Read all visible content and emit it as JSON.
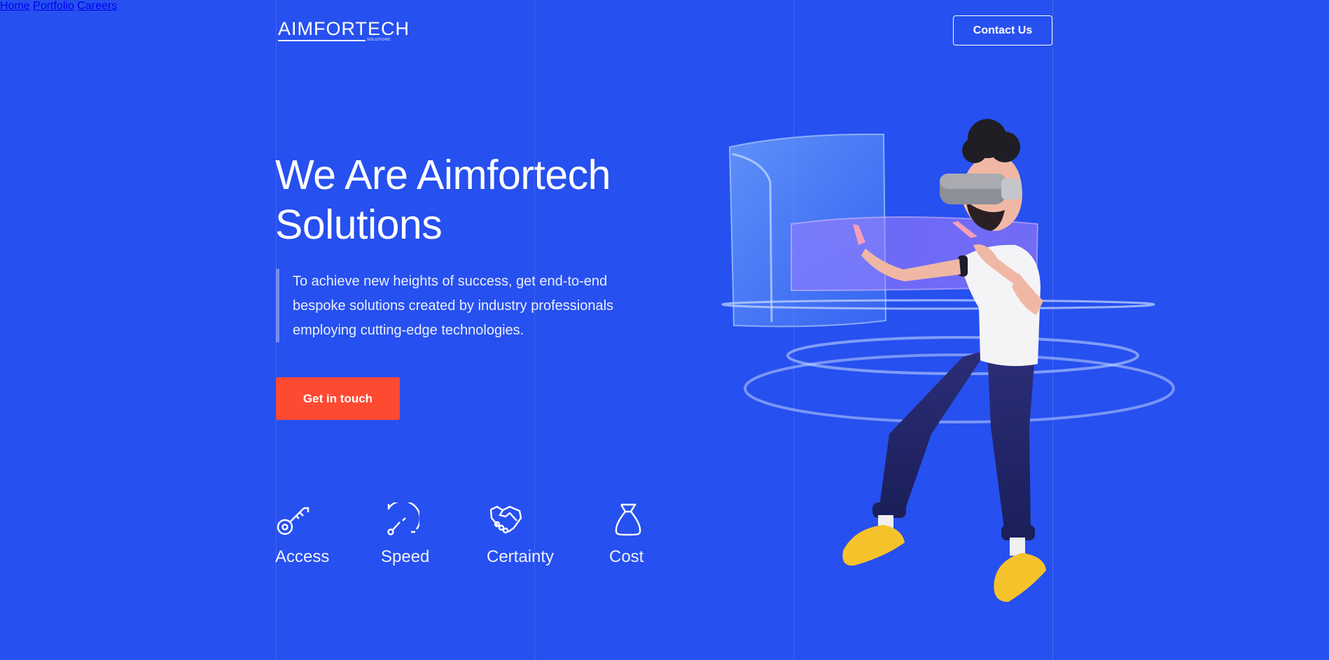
{
  "brand": {
    "logo_text": "AIMFORTECH",
    "logo_subtext": "SOLUTIONS"
  },
  "nav": {
    "items": [
      {
        "label": "Home"
      },
      {
        "label": "Portfolio"
      },
      {
        "label": "Careers"
      }
    ],
    "contact_label": "Contact Us"
  },
  "hero": {
    "title_line1": "We Are Aimfortech",
    "title_line2": "Solutions",
    "description": "To achieve new heights of success, get end-to-end bespoke solutions created by industry professionals employing cutting-edge technologies.",
    "cta_label": "Get in touch"
  },
  "features": [
    {
      "label": "Access",
      "icon": "key-icon"
    },
    {
      "label": "Speed",
      "icon": "speedometer-icon"
    },
    {
      "label": "Certainty",
      "icon": "handshake-icon"
    },
    {
      "label": "Cost",
      "icon": "money-bag-icon"
    }
  ],
  "colors": {
    "background": "#2650ef",
    "accent": "#ff4a32",
    "text": "#ffffff"
  }
}
